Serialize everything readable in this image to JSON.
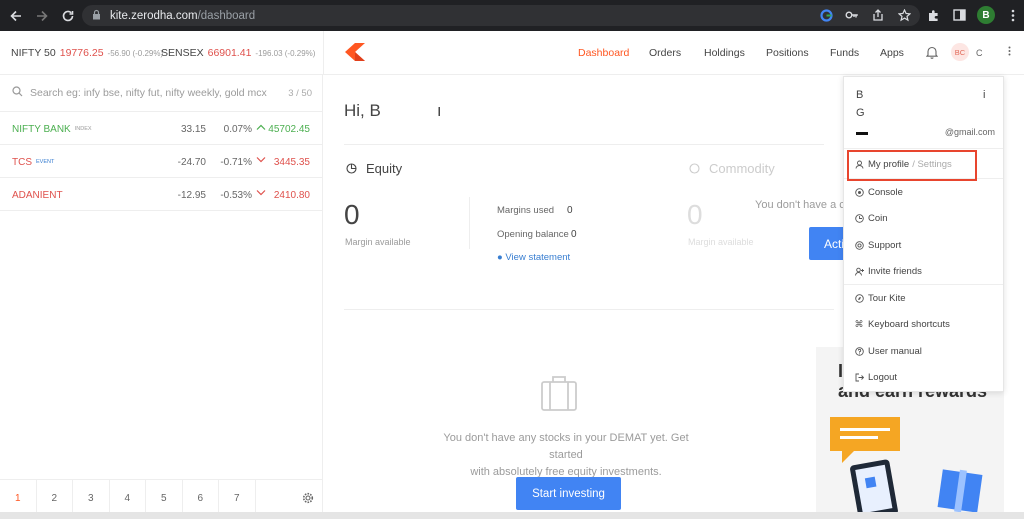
{
  "browser": {
    "url_host": "kite.zerodha.com",
    "url_path": "/dashboard",
    "profile_initial": "B"
  },
  "indices": [
    {
      "name": "NIFTY 50",
      "value": "19776.25",
      "change": "-56.90 (-0.29%)"
    },
    {
      "name": "SENSEX",
      "value": "66901.41",
      "change": "-196.03 (-0.29%)"
    }
  ],
  "nav": {
    "items": [
      "Dashboard",
      "Orders",
      "Holdings",
      "Positions",
      "Funds",
      "Apps"
    ],
    "active": "Dashboard",
    "avatar_initials": "BC",
    "user_id_partial": "C"
  },
  "watchlist": {
    "search_placeholder": "Search eg: infy bse, nifty fut, nifty weekly, gold mcx",
    "count": "3 / 50",
    "rows": [
      {
        "symbol": "NIFTY BANK",
        "tag": "INDEX",
        "change": "33.15",
        "pct": "0.07%",
        "direction": "up",
        "ltp": "45702.45"
      },
      {
        "symbol": "TCS",
        "tag": "EVENT",
        "change": "-24.70",
        "pct": "-0.71%",
        "direction": "down",
        "ltp": "3445.35"
      },
      {
        "symbol": "ADANIENT",
        "tag": "",
        "change": "-12.95",
        "pct": "-0.53%",
        "direction": "down",
        "ltp": "2410.80"
      }
    ],
    "pages": [
      "1",
      "2",
      "3",
      "4",
      "5",
      "6",
      "7"
    ],
    "active_page": "1"
  },
  "dashboard": {
    "greeting": "Hi, B",
    "greeting_tail": "ı",
    "equity": {
      "title": "Equity",
      "margin_available": "0",
      "margin_label": "Margin available",
      "margins_used_label": "Margins used",
      "margins_used": "0",
      "opening_balance_label": "Opening balance",
      "opening_balance": "0",
      "view_statement": "View statement"
    },
    "commodity": {
      "title": "Commodity",
      "margin_available": "0",
      "margin_label": "Margin available",
      "no_account_text": "You don't have a c",
      "activate_label": "Acti"
    },
    "holdings_empty_line1": "You don't have any stocks in your DEMAT yet. Get started",
    "holdings_empty_line2": "with absolutely free equity investments.",
    "start_investing": "Start investing",
    "promo_text_line1": "I",
    "promo_text_line2": "and earn rewards"
  },
  "profile_menu": {
    "name_line1": "B",
    "name_line1_end": "i",
    "name_line2": "G",
    "email": "@gmail.com",
    "my_profile": "My profile",
    "settings": "/ Settings",
    "items": [
      "Console",
      "Coin",
      "Support",
      "Invite friends",
      "Tour Kite",
      "Keyboard shortcuts",
      "User manual",
      "Logout"
    ]
  },
  "colors": {
    "accent": "#ff5722",
    "up": "#4caf50",
    "down": "#df514c",
    "button_blue": "#4184f3",
    "highlight": "#e8452e"
  }
}
